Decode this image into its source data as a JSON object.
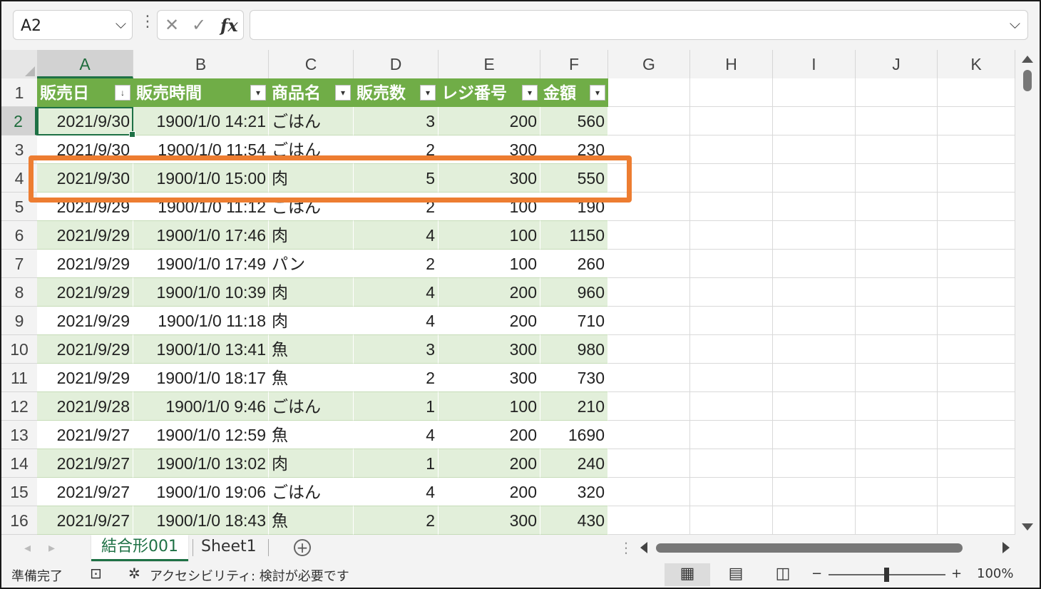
{
  "formula_bar": {
    "name_box": "A2",
    "cancel_glyph": "✕",
    "enter_glyph": "✓",
    "fx_label": "fx",
    "formula": ""
  },
  "columns": [
    "A",
    "B",
    "C",
    "D",
    "E",
    "F",
    "G",
    "H",
    "I",
    "J",
    "K"
  ],
  "table_headers": [
    "販売日",
    "販売時間",
    "商品名",
    "販売数",
    "レジ番号",
    "金額"
  ],
  "sort_indicator": "↓",
  "filter_glyph": "▾",
  "rows": [
    {
      "num": "1"
    },
    {
      "num": "2",
      "cells": [
        "2021/9/30",
        "1900/1/0 14:21",
        "ごはん",
        "3",
        "200",
        "560"
      ]
    },
    {
      "num": "3",
      "cells": [
        "2021/9/30",
        "1900/1/0 11:54",
        "ごはん",
        "2",
        "300",
        "230"
      ]
    },
    {
      "num": "4",
      "cells": [
        "2021/9/30",
        "1900/1/0 15:00",
        "肉",
        "5",
        "300",
        "550"
      ]
    },
    {
      "num": "5",
      "cells": [
        "2021/9/29",
        "1900/1/0 11:12",
        "ごはん",
        "2",
        "100",
        "190"
      ]
    },
    {
      "num": "6",
      "cells": [
        "2021/9/29",
        "1900/1/0 17:46",
        "肉",
        "4",
        "100",
        "1150"
      ]
    },
    {
      "num": "7",
      "cells": [
        "2021/9/29",
        "1900/1/0 17:49",
        "パン",
        "2",
        "100",
        "260"
      ]
    },
    {
      "num": "8",
      "cells": [
        "2021/9/29",
        "1900/1/0 10:39",
        "肉",
        "4",
        "200",
        "960"
      ]
    },
    {
      "num": "9",
      "cells": [
        "2021/9/29",
        "1900/1/0 11:18",
        "肉",
        "4",
        "200",
        "710"
      ]
    },
    {
      "num": "10",
      "cells": [
        "2021/9/29",
        "1900/1/0 13:41",
        "魚",
        "3",
        "300",
        "980"
      ]
    },
    {
      "num": "11",
      "cells": [
        "2021/9/29",
        "1900/1/0 18:17",
        "魚",
        "2",
        "300",
        "730"
      ]
    },
    {
      "num": "12",
      "cells": [
        "2021/9/28",
        "1900/1/0 9:46",
        "ごはん",
        "1",
        "100",
        "210"
      ]
    },
    {
      "num": "13",
      "cells": [
        "2021/9/27",
        "1900/1/0 12:59",
        "魚",
        "4",
        "200",
        "1690"
      ]
    },
    {
      "num": "14",
      "cells": [
        "2021/9/27",
        "1900/1/0 13:02",
        "肉",
        "1",
        "200",
        "240"
      ]
    },
    {
      "num": "15",
      "cells": [
        "2021/9/27",
        "1900/1/0 19:06",
        "ごはん",
        "4",
        "200",
        "320"
      ]
    },
    {
      "num": "16",
      "cells": [
        "2021/9/27",
        "1900/1/0 18:43",
        "魚",
        "2",
        "300",
        "430"
      ]
    }
  ],
  "highlighted_row": "4",
  "sheets": [
    {
      "name": "結合形001",
      "active": true
    },
    {
      "name": "Sheet1",
      "active": false
    }
  ],
  "add_sheet_glyph": "+",
  "status": {
    "ready": "準備完了",
    "accessibility": "アクセシビリティ: 検討が必要です",
    "zoom": "100%",
    "zoom_minus": "−",
    "zoom_plus": "+"
  },
  "colors": {
    "table_header": "#70ad47",
    "band": "#e2efda",
    "selection": "#1e7145",
    "highlight_box": "#ed7d31"
  }
}
